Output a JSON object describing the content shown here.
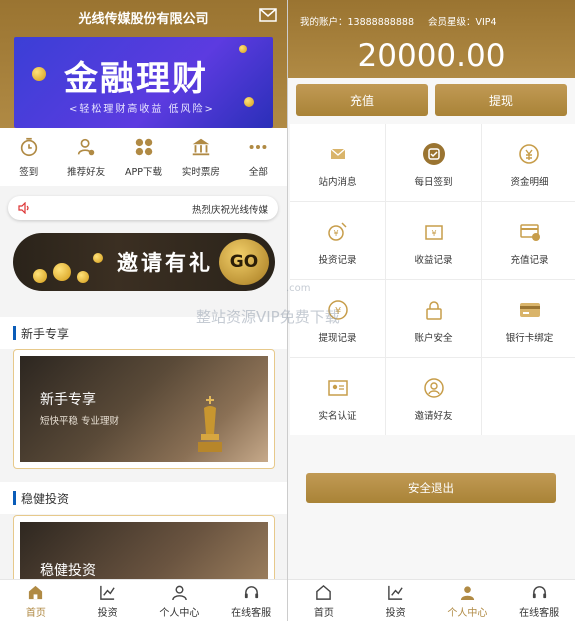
{
  "left": {
    "title": "光线传媒股份有限公司",
    "banner": {
      "title": "金融理财",
      "subtitle": "<轻松理财高收益 低风险>"
    },
    "menu": [
      {
        "label": "签到",
        "icon": "checkin-icon"
      },
      {
        "label": "推荐好友",
        "icon": "user-recommend-icon"
      },
      {
        "label": "APP下载",
        "icon": "app-grid-icon"
      },
      {
        "label": "实时票房",
        "icon": "bank-icon"
      },
      {
        "label": "全部",
        "icon": "more-dots-icon"
      }
    ],
    "notice": "热烈庆祝光线传媒",
    "invite": {
      "text": "邀请有礼",
      "go": "GO"
    },
    "sections": [
      {
        "title": "新手专享",
        "card_title": "新手专享",
        "card_sub": "短快平稳 专业理财"
      },
      {
        "title": "稳健投资",
        "card_title": "稳健投资"
      }
    ],
    "tabs": [
      {
        "label": "首页",
        "icon": "home-icon",
        "active": true
      },
      {
        "label": "投资",
        "icon": "chart-icon",
        "active": false
      },
      {
        "label": "个人中心",
        "icon": "user-icon",
        "active": false
      },
      {
        "label": "在线客服",
        "icon": "headset-icon",
        "active": false
      }
    ]
  },
  "right": {
    "account_label": "我的账户：13888888888",
    "vip_label": "会员星级：VIP4",
    "balance": "20000.00",
    "buttons": {
      "recharge": "充值",
      "withdraw": "提现"
    },
    "grid": [
      {
        "label": "站内消息",
        "icon": "mail-icon"
      },
      {
        "label": "每日签到",
        "icon": "checkin-icon"
      },
      {
        "label": "资金明细",
        "icon": "yuan-coin-icon"
      },
      {
        "label": "投资记录",
        "icon": "invest-record-icon"
      },
      {
        "label": "收益记录",
        "icon": "income-record-icon"
      },
      {
        "label": "充值记录",
        "icon": "recharge-card-icon"
      },
      {
        "label": "提现记录",
        "icon": "withdraw-record-icon"
      },
      {
        "label": "账户安全",
        "icon": "lock-icon"
      },
      {
        "label": "银行卡绑定",
        "icon": "bank-card-icon"
      },
      {
        "label": "实名认证",
        "icon": "id-card-icon"
      },
      {
        "label": "邀请好友",
        "icon": "invite-user-icon"
      }
    ],
    "logout": "安全退出",
    "tabs": [
      {
        "label": "首页",
        "icon": "home-icon",
        "active": false
      },
      {
        "label": "投资",
        "icon": "chart-icon",
        "active": false
      },
      {
        "label": "个人中心",
        "icon": "user-icon",
        "active": true
      },
      {
        "label": "在线客服",
        "icon": "headset-icon",
        "active": false
      }
    ]
  },
  "watermark": {
    "text": "整站资源VIP免费下载",
    "sub": ".com"
  },
  "colors": {
    "gold": "#b08a44",
    "gold_dark": "#9a7431",
    "section_bar": "#0a5cb8",
    "card_border": "#e7c98b"
  }
}
